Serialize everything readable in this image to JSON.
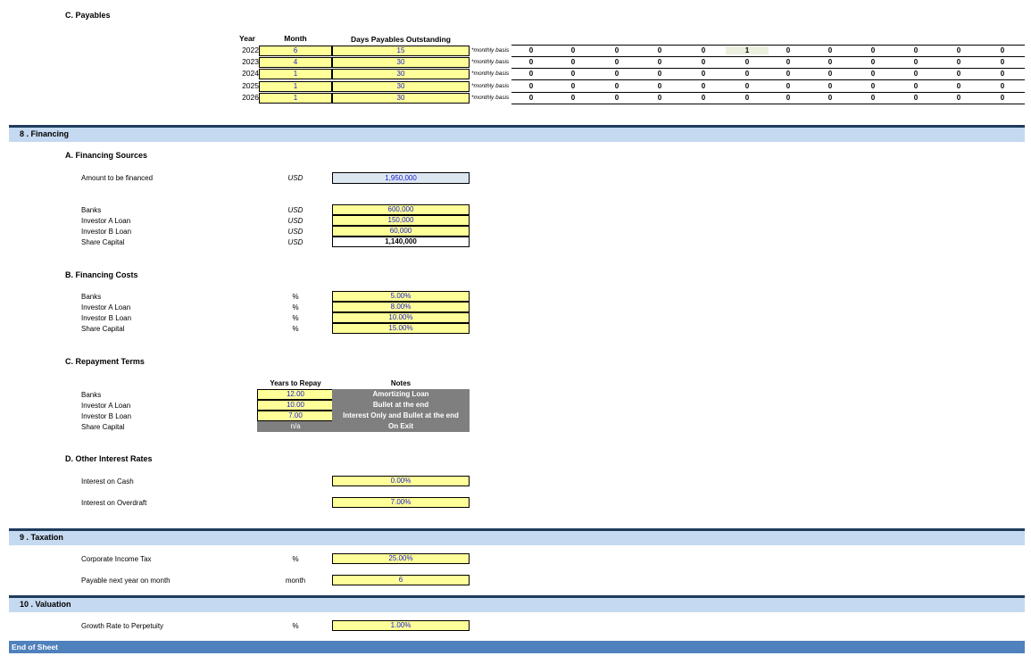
{
  "payables": {
    "title": "C.   Payables",
    "headers": {
      "year": "Year",
      "month": "Month",
      "dpo": "Days Payables Outstanding"
    },
    "rows": [
      {
        "year": "2022",
        "month": "6",
        "dpo": "15",
        "basis": "*monthly basis",
        "values": [
          "0",
          "0",
          "0",
          "0",
          "0",
          "1",
          "0",
          "0",
          "0",
          "0",
          "0",
          "0"
        ]
      },
      {
        "year": "2023",
        "month": "4",
        "dpo": "30",
        "basis": "*monthly basis",
        "values": [
          "0",
          "0",
          "0",
          "0",
          "0",
          "0",
          "0",
          "0",
          "0",
          "0",
          "0",
          "0"
        ]
      },
      {
        "year": "2024",
        "month": "1",
        "dpo": "30",
        "basis": "*monthly basis",
        "values": [
          "0",
          "0",
          "0",
          "0",
          "0",
          "0",
          "0",
          "0",
          "0",
          "0",
          "0",
          "0"
        ]
      },
      {
        "year": "2025",
        "month": "1",
        "dpo": "30",
        "basis": "*monthly basis",
        "values": [
          "0",
          "0",
          "0",
          "0",
          "0",
          "0",
          "0",
          "0",
          "0",
          "0",
          "0",
          "0"
        ]
      },
      {
        "year": "2026",
        "month": "1",
        "dpo": "30",
        "basis": "*monthly basis",
        "values": [
          "0",
          "0",
          "0",
          "0",
          "0",
          "0",
          "0",
          "0",
          "0",
          "0",
          "0",
          "0"
        ]
      }
    ]
  },
  "financing": {
    "section": "8 . Financing",
    "sources_title": "A.   Financing Sources",
    "amount_label": "Amount to be financed",
    "amount_unit": "USD",
    "amount_value": "1,950,000",
    "sources": [
      {
        "label": "Banks",
        "unit": "USD",
        "value": "600,000"
      },
      {
        "label": "Investor A Loan",
        "unit": "USD",
        "value": "150,000"
      },
      {
        "label": "Investor B Loan",
        "unit": "USD",
        "value": "60,000"
      },
      {
        "label": "Share Capital",
        "unit": "USD",
        "value": "1,140,000"
      }
    ],
    "costs_title": "B.   Financing Costs",
    "costs": [
      {
        "label": "Banks",
        "unit": "%",
        "value": "5.00%"
      },
      {
        "label": "Investor A Loan",
        "unit": "%",
        "value": "8.00%"
      },
      {
        "label": "Investor B Loan",
        "unit": "%",
        "value": "10.00%"
      },
      {
        "label": "Share Capital",
        "unit": "%",
        "value": "15.00%"
      }
    ],
    "repay_title": "C.   Repayment Terms",
    "repay_headers": {
      "years": "Years to Repay",
      "notes": "Notes"
    },
    "repay": [
      {
        "label": "Banks",
        "years": "12.00",
        "notes": "Amortizing Loan"
      },
      {
        "label": "Investor A Loan",
        "years": "10.00",
        "notes": "Bullet at the end"
      },
      {
        "label": "Investor B Loan",
        "years": "7.00",
        "notes": "Interest Only and Bullet at the end"
      },
      {
        "label": "Share Capital",
        "years": "n/a",
        "notes": "On Exit"
      }
    ],
    "other_title": "D.   Other Interest Rates",
    "cash_label": "Interest on Cash",
    "cash_value": "0.00%",
    "overdraft_label": "Interest on Overdraft",
    "overdraft_value": "7.00%"
  },
  "taxation": {
    "section": "9 . Taxation",
    "cit_label": "Corporate Income Tax",
    "cit_unit": "%",
    "cit_value": "25.00%",
    "payable_label": "Payable next year on month",
    "payable_unit": "month",
    "payable_value": "6"
  },
  "valuation": {
    "section": "10 . Valuation",
    "growth_label": "Growth Rate to Perpetuity",
    "growth_unit": "%",
    "growth_value": "1.00%"
  },
  "end_label": "End of Sheet",
  "colors": {
    "input": "#ffff99",
    "band": "#c5d9f1",
    "band_border": "#1f3b5c",
    "end_bar": "#4f81bd",
    "grey_cell": "#7f7f7f",
    "input_text": "#1a1acc"
  }
}
